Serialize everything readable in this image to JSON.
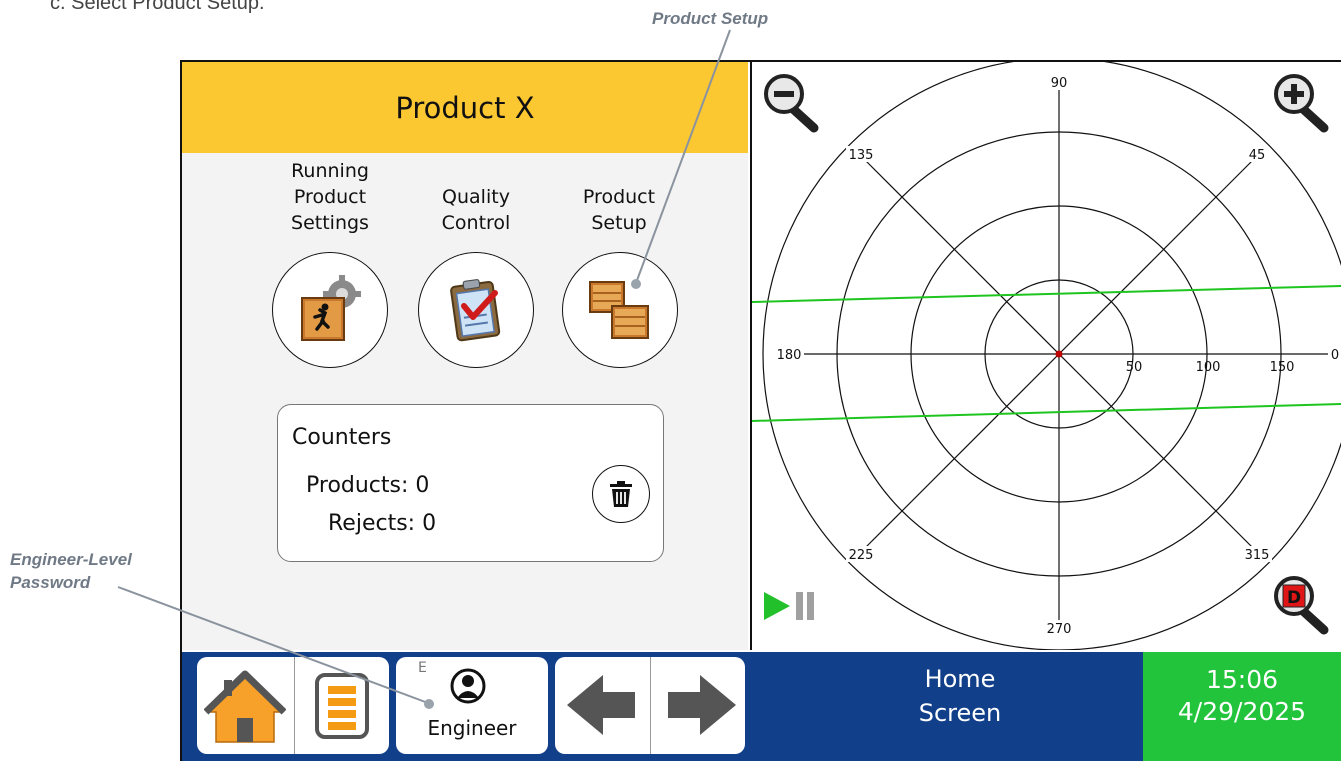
{
  "instruction": "c. Select Product Setup.",
  "callouts": {
    "product_setup": "Product Setup",
    "engineer_password_line1": "Engineer-Level",
    "engineer_password_line2": "Password"
  },
  "header": {
    "product_name": "Product X"
  },
  "menu": {
    "running_settings": [
      "Running",
      "Product",
      "Settings"
    ],
    "quality_control": [
      "Quality",
      "Control"
    ],
    "product_setup": [
      "Product",
      "Setup"
    ]
  },
  "counters": {
    "title": "Counters",
    "products_label": "Products: 0",
    "rejects_label": "Rejects: 0"
  },
  "polar": {
    "angle_labels": {
      "a90": "90",
      "a45": "45",
      "a135": "135",
      "a180": "180",
      "a0": "0",
      "a225": "225",
      "a270": "270",
      "a315": "315"
    },
    "radius_labels": [
      "50",
      "100",
      "150"
    ],
    "radius_values": [
      50,
      100,
      150,
      200
    ],
    "zoom_badge_letter": "D",
    "colors": {
      "signal_line": "#1fc51f",
      "center_point": "#c00000",
      "play_icon": "#22c02a"
    }
  },
  "bottom_bar": {
    "user_level_letter": "E",
    "user_name": "Engineer",
    "screen_name_line1": "Home",
    "screen_name_line2": "Screen",
    "time": "15:06",
    "date": "4/29/2025",
    "colors": {
      "bar": "#113f8a",
      "datetime": "#21c43a",
      "header": "#fcc832",
      "menu_icon": "#f59a13"
    }
  }
}
